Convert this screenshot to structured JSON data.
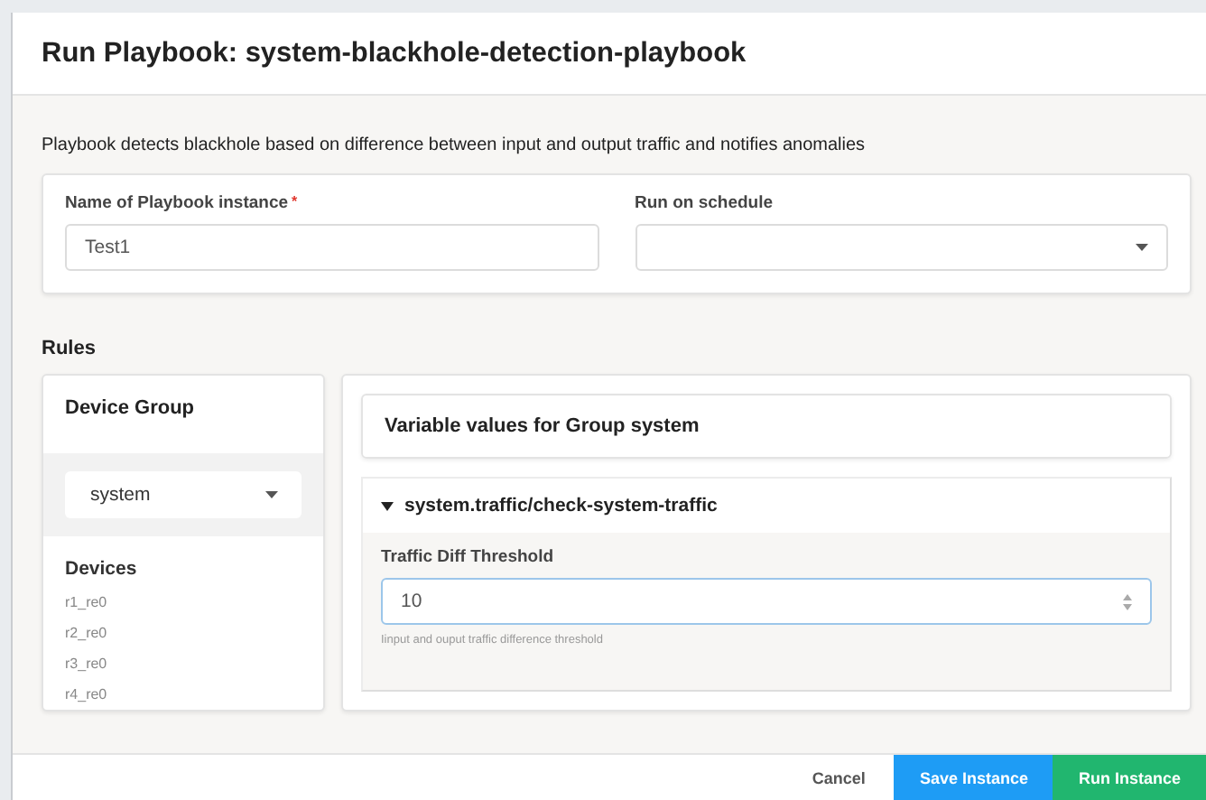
{
  "dialog": {
    "title": "Run Playbook: system-blackhole-detection-playbook",
    "description": "Playbook detects blackhole based on difference between input and output traffic and notifies anomalies"
  },
  "instance": {
    "name_label": "Name of Playbook instance",
    "required_mark": "*",
    "name_value": "Test1",
    "schedule_label": "Run on schedule"
  },
  "rules": {
    "title": "Rules",
    "device_group": {
      "title": "Device Group",
      "selected_group": "system",
      "devices_title": "Devices",
      "devices": [
        "r1_re0",
        "r2_re0",
        "r3_re0",
        "r4_re0"
      ]
    },
    "variables": {
      "title": "Variable values for Group system",
      "sections": [
        {
          "title": "system.traffic/check-system-traffic",
          "expanded": true,
          "fields": [
            {
              "label": "Traffic Diff Threshold",
              "value": "10",
              "focused": true,
              "hint": "Iinput and ouput traffic difference threshold"
            }
          ]
        }
      ]
    }
  },
  "footer": {
    "buttons": [
      {
        "label": "Cancel",
        "kind": "plain"
      },
      {
        "label": "Save Instance",
        "kind": "save"
      },
      {
        "label": "Run Instance",
        "kind": "run"
      }
    ]
  }
}
